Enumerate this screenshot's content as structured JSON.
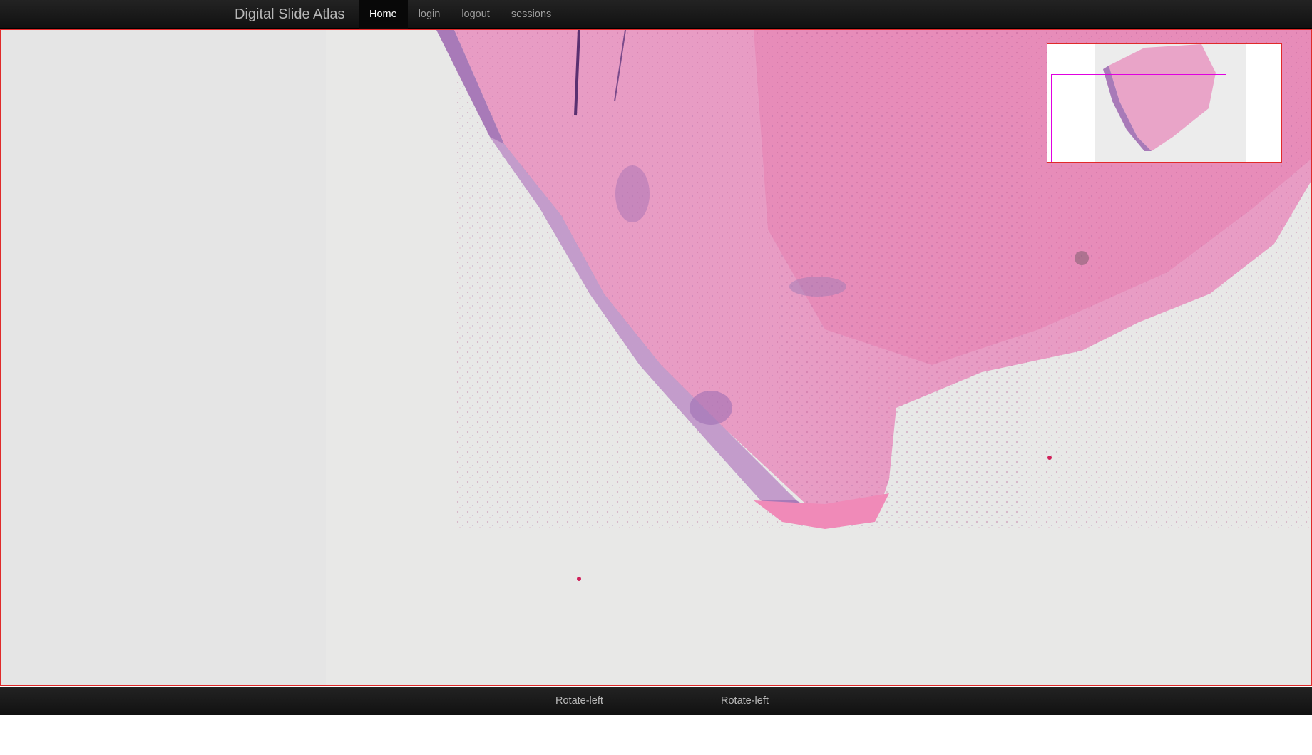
{
  "navbar": {
    "brand": "Digital Slide Atlas",
    "items": [
      {
        "label": "Home",
        "active": true
      },
      {
        "label": "login",
        "active": false
      },
      {
        "label": "logout",
        "active": false
      },
      {
        "label": "sessions",
        "active": false
      }
    ]
  },
  "viewer": {
    "border_color": "#e02a2a",
    "overview_viewport_color": "#e000e0",
    "tissue_colors": {
      "dermis": "#e89cc4",
      "epidermis": "#b58cc4"
    }
  },
  "bottombar": {
    "buttons": [
      "Rotate-left",
      "Rotate-left"
    ]
  }
}
